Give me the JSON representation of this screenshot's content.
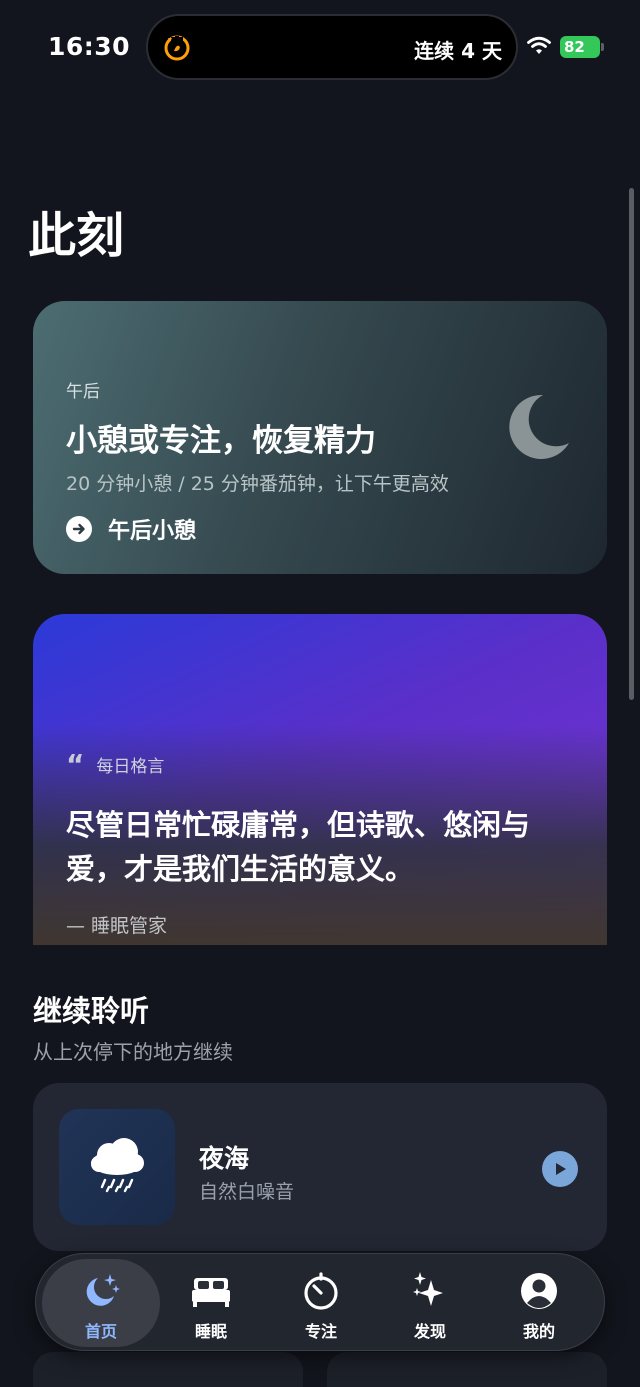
{
  "status_bar": {
    "time": "16:30",
    "streak": "连续 4 天",
    "battery": "82"
  },
  "page": {
    "title": "此刻"
  },
  "now_card": {
    "period": "午后",
    "title": "小憩或专注，恢复精力",
    "subtitle": "20 分钟小憩 / 25 分钟番茄钟，让下午更高效",
    "action_label": "午后小憩",
    "icon": "moon-icon"
  },
  "quote_card": {
    "tag": "每日格言",
    "text": "尽管日常忙碌庸常，但诗歌、悠闲与爱，才是我们生活的意义。",
    "author": "— 睡眠管家"
  },
  "continue_section": {
    "title": "继续聆听",
    "subtitle": "从上次停下的地方继续",
    "track": {
      "title": "夜海",
      "category": "自然白噪音",
      "icon": "rain-cloud-icon"
    }
  },
  "tabbar": {
    "items": [
      {
        "label": "首页",
        "icon": "moon-stars-icon",
        "active": true
      },
      {
        "label": "睡眠",
        "icon": "bed-icon",
        "active": false
      },
      {
        "label": "专注",
        "icon": "timer-icon",
        "active": false
      },
      {
        "label": "发现",
        "icon": "sparkles-icon",
        "active": false
      },
      {
        "label": "我的",
        "icon": "person-icon",
        "active": false
      }
    ]
  },
  "colors": {
    "background": "#12151d",
    "accent": "#8fb8ff",
    "streak_icon": "#ff9f0a",
    "battery": "#34c759"
  }
}
